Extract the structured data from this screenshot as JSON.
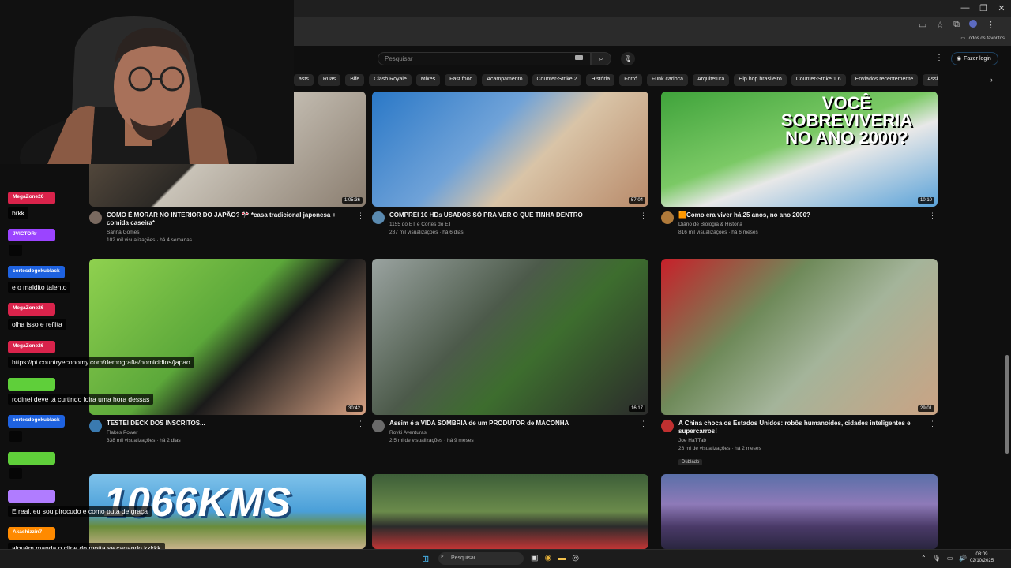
{
  "browser": {
    "bookmarks_label": "Todos os favoritos"
  },
  "header": {
    "search_placeholder": "Pesquisar",
    "login_label": "Fazer login"
  },
  "chips": [
    "asts",
    "Ruas",
    "Blfe",
    "Clash Royale",
    "Mixes",
    "Fast food",
    "Acampamento",
    "Counter-Strike 2",
    "História",
    "Forró",
    "Funk carioca",
    "Arquitetura",
    "Hip hop brasileiro",
    "Counter-Strike 1.6",
    "Enviados recentemente",
    "Assi"
  ],
  "videos": [
    {
      "title": "COMO É MORAR NO INTERIOR DO JAPÃO? 🎌 *casa tradicional japonesa + comida caseira*",
      "channel": "Sarina Gomes",
      "meta": "102 mil visualizações · há 4 semanas",
      "duration": "1:05:36"
    },
    {
      "title": "COMPREI 10 HDs USADOS SÓ PRA VER O QUE TINHA DENTRO",
      "channel": "1155 do ET e Cortes do ET",
      "meta": "287 mil visualizações · há 6 dias",
      "duration": "57:04"
    },
    {
      "title": "🟧Como era viver há 25 anos, no ano 2000?",
      "channel": "Diário de Biologia & História",
      "meta": "816 mil visualizações · há 6 meses",
      "duration": "10:10",
      "thumb_text": "VOCÊ SOBREVIVERIA NO ANO 2000?"
    },
    {
      "title": "TESTEI DECK DOS INSCRITOS...",
      "channel": "Flakes Power",
      "meta": "338 mil visualizações · há 2 dias",
      "duration": "30:42"
    },
    {
      "title": "Assim é a VIDA SOMBRIA de um PRODUTOR de MACONHA",
      "channel": "Royki Aventuras",
      "meta": "2,5 mi de visualizações · há 9 meses",
      "duration": "16:17"
    },
    {
      "title": "A China choca os Estados Unidos: robôs humanoides, cidades inteligentes e supercarros!",
      "channel": "Joe HaTTab",
      "meta": "26 mi de visualizações · há 2 meses",
      "duration": "29:01",
      "badge": "Dublado"
    },
    {
      "title": "",
      "channel": "",
      "meta": "",
      "duration": "",
      "thumb_text": "1066KMS"
    },
    {
      "title": "",
      "channel": "",
      "meta": "",
      "duration": ""
    },
    {
      "title": "",
      "channel": "",
      "meta": "",
      "duration": ""
    }
  ],
  "chat": [
    {
      "name": "MegaZone26",
      "color": "#d9234b",
      "message": "brkk"
    },
    {
      "name": "JVICTORr",
      "color": "#9b44ff",
      "message": ""
    },
    {
      "name": "cortesdogokublack",
      "color": "#1e62e0",
      "message": "e o maldito talento"
    },
    {
      "name": "MegaZone26",
      "color": "#d9234b",
      "message": "olha isso e reflita"
    },
    {
      "name": "MegaZone26",
      "color": "#d9234b",
      "message": "https://pt.countryeconomy.com/demografia/homicidios/japao"
    },
    {
      "name": "",
      "color": "#5fcf3a",
      "message": "rodinei deve tá curtindo loira uma hora dessas"
    },
    {
      "name": "cortesdogokublack",
      "color": "#1e62e0",
      "message": ""
    },
    {
      "name": "",
      "color": "#5fcf3a",
      "message": ""
    },
    {
      "name": "",
      "color": "#b07cff",
      "message": "E real, eu sou pirocudo e como puta de graça"
    },
    {
      "name": "Akashizzin7",
      "color": "#ff8a00",
      "message": "alguém manda o clipe do motta se cagando kkkkk"
    }
  ],
  "taskbar": {
    "search_label": "Pesquisar",
    "time": "03:09",
    "date": "02/10/2025"
  }
}
